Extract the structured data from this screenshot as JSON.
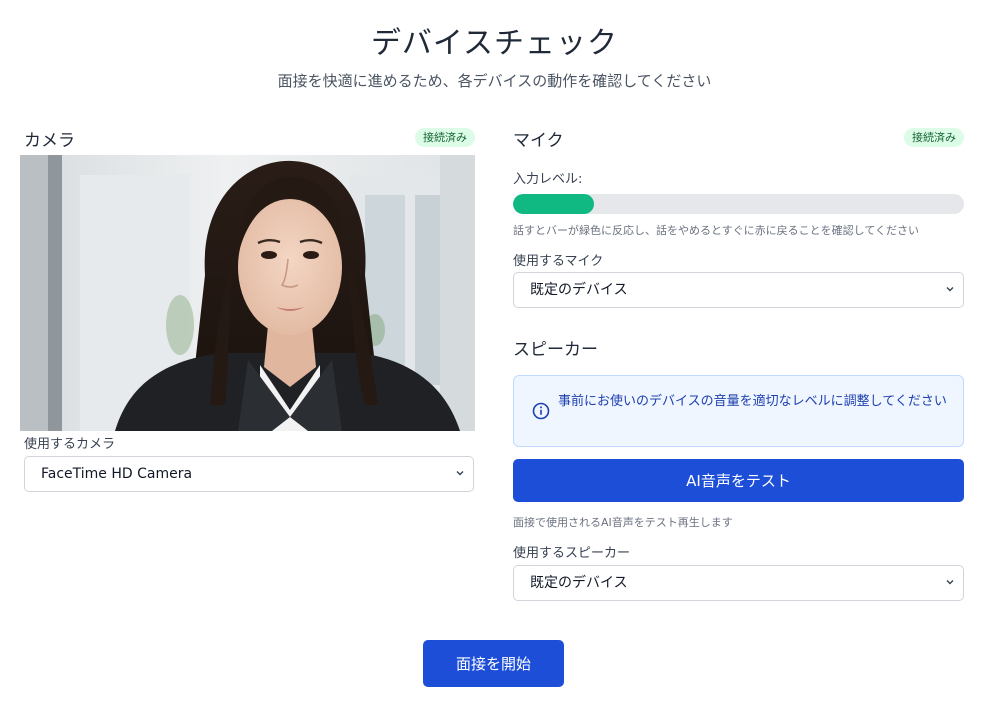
{
  "header": {
    "title": "デバイスチェック",
    "subtitle": "面接を快適に進めるため、各デバイスの動作を確認してください"
  },
  "camera": {
    "title": "カメラ",
    "status_badge": "接続済み",
    "select_label": "使用するカメラ",
    "selected": "FaceTime HD Camera"
  },
  "microphone": {
    "title": "マイク",
    "status_badge": "接続済み",
    "level_label": "入力レベル:",
    "level_fraction": 0.18,
    "level_hint": "話すとバーが緑色に反応し、話をやめるとすぐに赤に戻ることを確認してください",
    "select_label": "使用するマイク",
    "selected": "既定のデバイス"
  },
  "speaker": {
    "title": "スピーカー",
    "info_text": "事前にお使いのデバイスの音量を適切なレベルに調整してください",
    "test_button": "AI音声をテスト",
    "test_hint": "面接で使用されるAI音声をテスト再生します",
    "select_label": "使用するスピーカー",
    "selected": "既定のデバイス"
  },
  "actions": {
    "start_button": "面接を開始"
  },
  "colors": {
    "primary": "#1d4ed8",
    "level_green": "#10b981",
    "badge_bg": "#dcfce7",
    "badge_text": "#166534",
    "info_bg": "#eff6ff"
  }
}
